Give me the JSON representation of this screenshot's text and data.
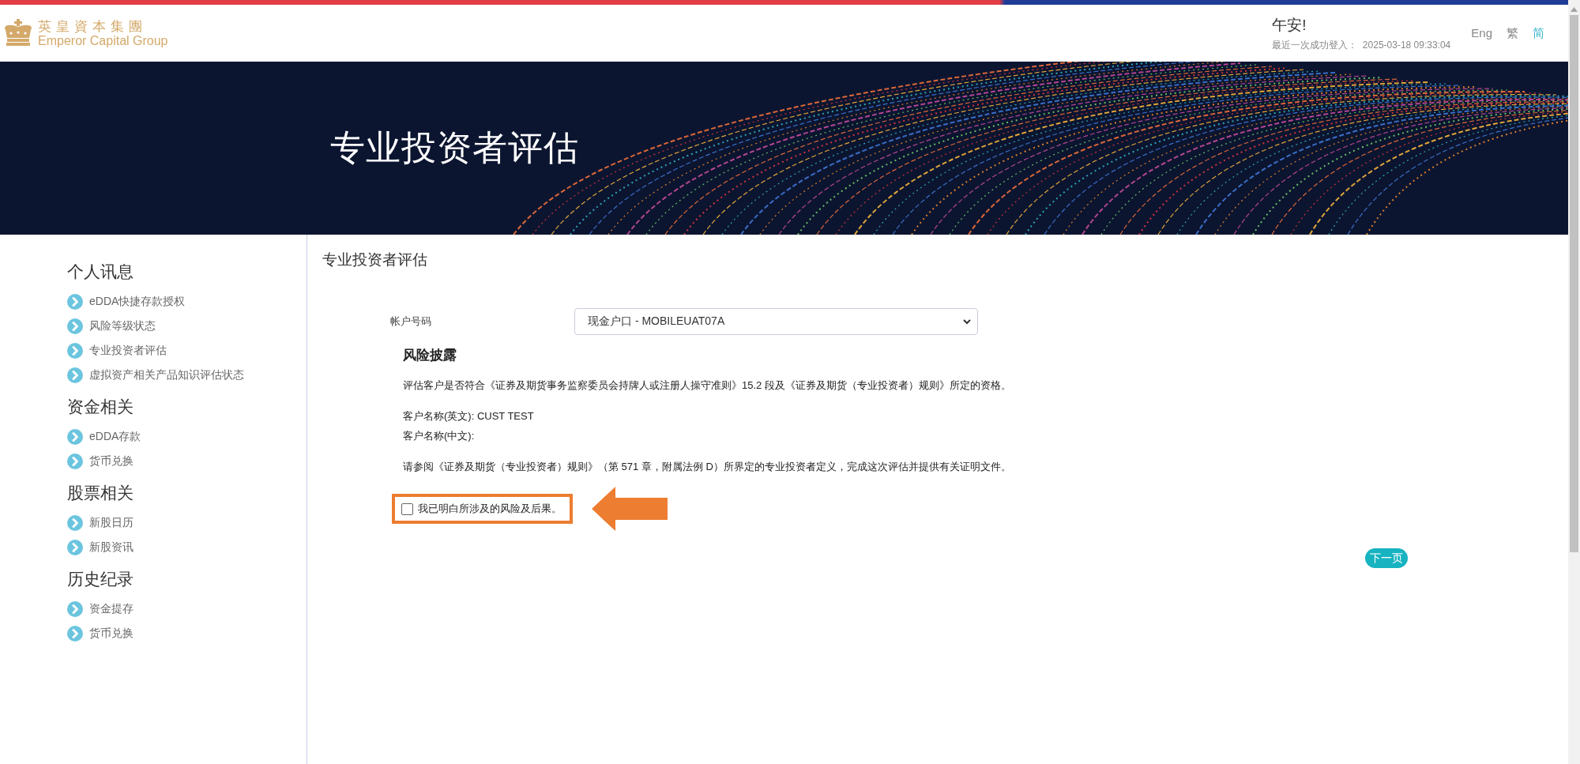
{
  "header": {
    "logo_chinese": "英皇資本集團",
    "logo_english": "Emperor Capital Group",
    "greeting": "午安!",
    "last_login": "最近一次成功登入：  2025-03-18 09:33:04",
    "languages": [
      {
        "label": "Eng",
        "selected": false
      },
      {
        "label": "繁",
        "selected": false
      },
      {
        "label": "简",
        "selected": true
      }
    ]
  },
  "banner": {
    "title": "专业投资者评估"
  },
  "sidebar": {
    "sections": [
      {
        "heading": "个人讯息",
        "items": [
          "eDDA快捷存款授权",
          "风险等级状态",
          "专业投资者评估",
          "虚拟资产相关产品知识评估状态"
        ]
      },
      {
        "heading": "资金相关",
        "items": [
          "eDDA存款",
          "货币兑换"
        ]
      },
      {
        "heading": "股票相关",
        "items": [
          "新股日历",
          "新股资讯"
        ]
      },
      {
        "heading": "历史纪录",
        "items": [
          "资金提存",
          "货币兑换"
        ]
      }
    ]
  },
  "main": {
    "title": "专业投资者评估",
    "account_label": "帐户号码",
    "account_value": "现金户口 - MOBILEUAT07A",
    "section_title": "风险披露",
    "intro": "评估客户是否符合《证券及期货事务监察委员会持牌人或注册人操守准则》15.2 段及《证券及期货（专业投资者）规则》所定的资格。",
    "customer_name_en": "客户名称(英文): CUST TEST",
    "customer_name_zh": "客户名称(中文):",
    "reference": "请参阅《证券及期货（专业投资者）规则》（第 571 章，附属法例 D）所界定的专业投资者定义，完成这次评估并提供有关证明文件。",
    "acknowledgement": {
      "label": "我已明白所涉及的风险及后果。",
      "checked": false,
      "highlighted": true
    },
    "next_button": "下一页"
  }
}
